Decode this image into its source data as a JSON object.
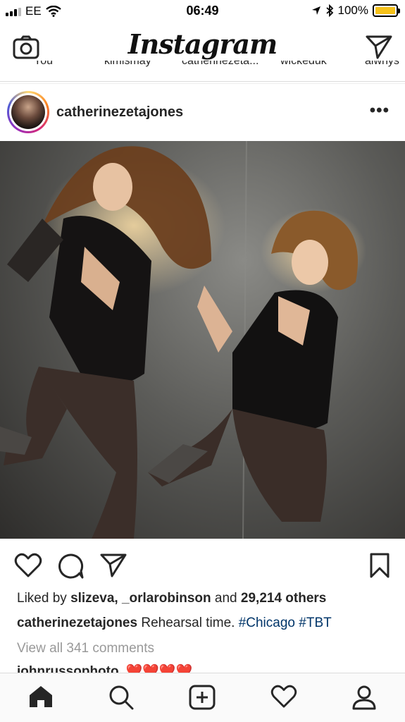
{
  "status_bar": {
    "carrier": "EE",
    "time": "06:49",
    "battery": "100%"
  },
  "header": {
    "logo": "Instagram",
    "camera_icon": "camera-icon",
    "direct_icon": "paper-plane-icon"
  },
  "stories": {
    "labels": [
      "You",
      "kimismay",
      "catherinezeta...",
      "wickeduk",
      "alwhys"
    ]
  },
  "post": {
    "username": "catherinezetajones",
    "more_label": "•••",
    "liked_by_prefix": "Liked by",
    "liker_1": "slizeva,",
    "liker_2": "_orlarobinson",
    "and_label": "and",
    "others": "29,214 others",
    "caption_user": "catherinezetajones",
    "caption_text": "Rehearsal time.",
    "hashtag_1": "#Chicago",
    "hashtag_2": "#TBT",
    "view_comments": "View all 341 comments",
    "next_comment_user": "johnrussophoto",
    "next_comment_text": "❤️❤️❤️❤️"
  },
  "tabbar": {
    "items": [
      "home-icon",
      "search-icon",
      "add-post-icon",
      "activity-heart-icon",
      "profile-icon"
    ]
  }
}
